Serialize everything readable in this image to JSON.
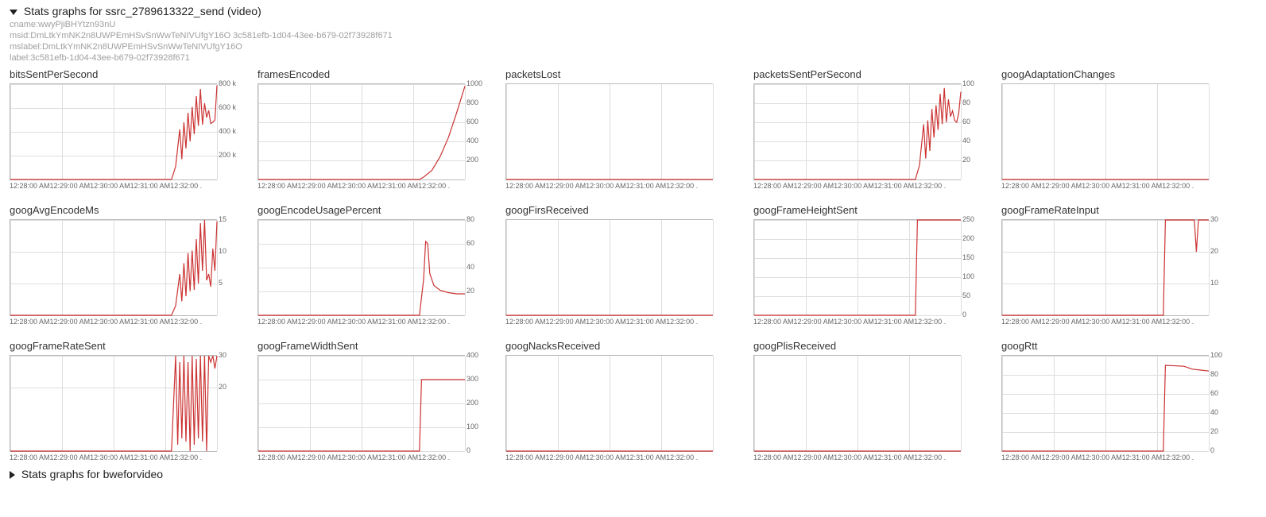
{
  "header": {
    "title": "Stats graphs for ssrc_2789613322_send (video)",
    "meta_lines": [
      "cname:wwyPjiBHYtzn93nU",
      "msid:DmLtkYmNK2n8UWPEmHSvSnWwTeNIVUfgY16O 3c581efb-1d04-43ee-b679-02f73928f671",
      "mslabel:DmLtkYmNK2n8UWPEmHSvSnWwTeNIVUfgY16O",
      "label:3c581efb-1d04-43ee-b679-02f73928f671"
    ]
  },
  "x_ticks": [
    "12:28:00 AM",
    "12:29:00 AM",
    "12:30:00 AM",
    "12:31:00 AM",
    "12:32:00 ."
  ],
  "footer": {
    "title": "Stats graphs for bweforvideo"
  },
  "chart_data": [
    {
      "title": "bitsSentPerSecond",
      "type": "line",
      "ylim": [
        0,
        800000
      ],
      "y_ticks": [
        "200 k",
        "400 k",
        "600 k",
        "800 k"
      ],
      "x": [
        0,
        0.78,
        0.8,
        0.82,
        0.83,
        0.84,
        0.85,
        0.86,
        0.87,
        0.88,
        0.89,
        0.9,
        0.91,
        0.92,
        0.93,
        0.94,
        0.95,
        0.96,
        0.97,
        0.98,
        0.99,
        1.0
      ],
      "y": [
        0,
        0,
        110000,
        420000,
        170000,
        480000,
        260000,
        560000,
        320000,
        610000,
        380000,
        700000,
        450000,
        760000,
        460000,
        640000,
        520000,
        580000,
        470000,
        480000,
        500000,
        790000
      ]
    },
    {
      "title": "framesEncoded",
      "type": "line",
      "ylim": [
        0,
        1000
      ],
      "y_ticks": [
        "200",
        "400",
        "600",
        "800",
        "1000"
      ],
      "x": [
        0,
        0.78,
        0.8,
        0.84,
        0.88,
        0.92,
        0.96,
        1.0
      ],
      "y": [
        0,
        0,
        25,
        95,
        240,
        440,
        700,
        980
      ]
    },
    {
      "title": "packetsLost",
      "type": "line",
      "ylim": [
        0,
        1
      ],
      "y_ticks": [],
      "x": [
        0,
        1.0
      ],
      "y": [
        0,
        0
      ]
    },
    {
      "title": "packetsSentPerSecond",
      "type": "line",
      "ylim": [
        0,
        100
      ],
      "y_ticks": [
        "20",
        "40",
        "60",
        "80",
        "100"
      ],
      "x": [
        0,
        0.78,
        0.8,
        0.82,
        0.83,
        0.84,
        0.85,
        0.86,
        0.87,
        0.88,
        0.89,
        0.9,
        0.91,
        0.92,
        0.93,
        0.94,
        0.95,
        0.96,
        0.97,
        0.98,
        0.99,
        1.0
      ],
      "y": [
        0,
        0,
        15,
        58,
        22,
        62,
        30,
        74,
        44,
        78,
        52,
        90,
        58,
        96,
        60,
        84,
        66,
        72,
        62,
        60,
        70,
        92
      ]
    },
    {
      "title": "googAdaptationChanges",
      "type": "line",
      "ylim": [
        0,
        1
      ],
      "y_ticks": [],
      "x": [
        0,
        1.0
      ],
      "y": [
        0,
        0
      ]
    },
    {
      "title": "googAvgEncodeMs",
      "type": "line",
      "ylim": [
        0,
        15
      ],
      "y_ticks": [
        "5",
        "10",
        "15"
      ],
      "x": [
        0,
        0.78,
        0.8,
        0.82,
        0.83,
        0.84,
        0.85,
        0.86,
        0.87,
        0.88,
        0.89,
        0.9,
        0.91,
        0.92,
        0.93,
        0.94,
        0.95,
        0.96,
        0.97,
        0.98,
        0.99,
        1.0
      ],
      "y": [
        0,
        0,
        1.5,
        6.5,
        2.2,
        8.2,
        3.0,
        9.8,
        3.8,
        10.2,
        4.0,
        12.0,
        5.0,
        14.5,
        7.0,
        15.0,
        5.5,
        6.5,
        4.5,
        10.5,
        7.0,
        14.8
      ]
    },
    {
      "title": "googEncodeUsagePercent",
      "type": "line",
      "ylim": [
        0,
        80
      ],
      "y_ticks": [
        "20",
        "40",
        "60",
        "80"
      ],
      "x": [
        0,
        0.78,
        0.8,
        0.81,
        0.82,
        0.83,
        0.85,
        0.88,
        0.92,
        0.96,
        1.0
      ],
      "y": [
        0,
        0,
        30,
        62,
        60,
        35,
        25,
        21,
        19,
        18,
        18
      ]
    },
    {
      "title": "googFirsReceived",
      "type": "line",
      "ylim": [
        0,
        1
      ],
      "y_ticks": [],
      "x": [
        0,
        1.0
      ],
      "y": [
        0,
        0
      ]
    },
    {
      "title": "googFrameHeightSent",
      "type": "line",
      "ylim": [
        0,
        250
      ],
      "y_ticks": [
        "0",
        "50",
        "100",
        "150",
        "200",
        "250"
      ],
      "x": [
        0,
        0.78,
        0.79,
        1.0
      ],
      "y": [
        0,
        0,
        250,
        250
      ]
    },
    {
      "title": "googFrameRateInput",
      "type": "line",
      "ylim": [
        0,
        30
      ],
      "y_ticks": [
        "10",
        "20",
        "30"
      ],
      "x": [
        0,
        0.78,
        0.79,
        0.9,
        0.93,
        0.94,
        0.95,
        0.96,
        1.0
      ],
      "y": [
        0,
        0,
        30,
        30,
        30,
        20,
        30,
        30,
        30
      ]
    },
    {
      "title": "googFrameRateSent",
      "type": "line",
      "ylim": [
        0,
        30
      ],
      "y_ticks": [
        "20",
        "30"
      ],
      "x": [
        0,
        0.78,
        0.8,
        0.81,
        0.82,
        0.83,
        0.84,
        0.85,
        0.86,
        0.87,
        0.88,
        0.89,
        0.9,
        0.91,
        0.92,
        0.93,
        0.94,
        0.95,
        0.96,
        0.97,
        0.98,
        0.99,
        1.0
      ],
      "y": [
        0,
        0,
        30,
        2,
        28,
        4,
        30,
        3,
        28,
        0,
        30,
        2,
        29,
        4,
        30,
        3,
        30,
        0,
        30,
        28,
        30,
        26,
        30
      ]
    },
    {
      "title": "googFrameWidthSent",
      "type": "line",
      "ylim": [
        0,
        400
      ],
      "y_ticks": [
        "0",
        "100",
        "200",
        "300",
        "400"
      ],
      "x": [
        0,
        0.78,
        0.79,
        1.0
      ],
      "y": [
        0,
        0,
        300,
        300
      ]
    },
    {
      "title": "googNacksReceived",
      "type": "line",
      "ylim": [
        0,
        1
      ],
      "y_ticks": [],
      "x": [
        0,
        1.0
      ],
      "y": [
        0,
        0
      ]
    },
    {
      "title": "googPlisReceived",
      "type": "line",
      "ylim": [
        0,
        1
      ],
      "y_ticks": [],
      "x": [
        0,
        1.0
      ],
      "y": [
        0,
        0
      ]
    },
    {
      "title": "googRtt",
      "type": "line",
      "ylim": [
        0,
        100
      ],
      "y_ticks": [
        "0",
        "20",
        "40",
        "60",
        "80",
        "100"
      ],
      "x": [
        0,
        0.78,
        0.79,
        0.88,
        0.92,
        0.96,
        1.0
      ],
      "y": [
        0,
        0,
        90,
        89,
        86,
        85,
        84
      ]
    }
  ]
}
